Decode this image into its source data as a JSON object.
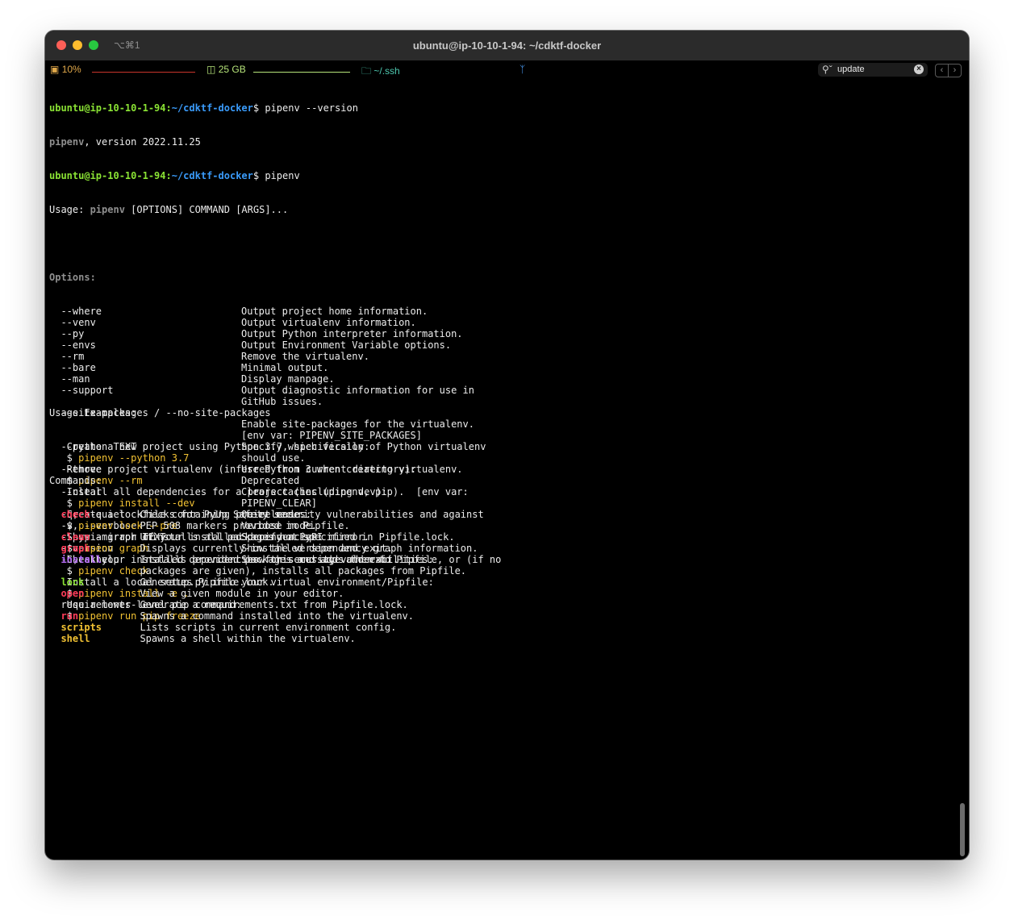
{
  "window": {
    "title": "ubuntu@ip-10-10-1-94: ~/cdktf-docker",
    "shortcut": "⌥⌘1"
  },
  "status": {
    "cpu": "10%",
    "disk": "25 GB",
    "dir": "~/.ssh"
  },
  "search": {
    "value": "update"
  },
  "prompt": {
    "user": "ubuntu@ip-10-10-1-94:",
    "path": "~/cdktf-docker",
    "symbol": "$"
  },
  "commands": {
    "first": " pipenv --version",
    "second": " pipenv"
  },
  "output": {
    "version_prog": "pipenv",
    "version_rest": ", version 2022.11.25",
    "usage_pre": "Usage: ",
    "usage_prog": "pipenv",
    "usage_rest": " [OPTIONS] COMMAND [ARGS]...",
    "options_header": "Options:",
    "options": [
      {
        "flag": "  --where",
        "desc": "Output project home information."
      },
      {
        "flag": "  --venv",
        "desc": "Output virtualenv information."
      },
      {
        "flag": "  --py",
        "desc": "Output Python interpreter information."
      },
      {
        "flag": "  --envs",
        "desc": "Output Environment Variable options."
      },
      {
        "flag": "  --rm",
        "desc": "Remove the virtualenv."
      },
      {
        "flag": "  --bare",
        "desc": "Minimal output."
      },
      {
        "flag": "  --man",
        "desc": "Display manpage."
      },
      {
        "flag": "  --support",
        "desc": "Output diagnostic information for use in"
      },
      {
        "flag": "",
        "desc": "GitHub issues."
      },
      {
        "flag": "  --site-packages / --no-site-packages",
        "desc": ""
      },
      {
        "flag": "",
        "desc": "Enable site-packages for the virtualenv."
      },
      {
        "flag": "",
        "desc": "[env var: PIPENV_SITE_PACKAGES]"
      },
      {
        "flag": "  --python TEXT",
        "desc": "Specify which version of Python virtualenv"
      },
      {
        "flag": "",
        "desc": "should use."
      },
      {
        "flag": "  --three",
        "desc": "Use Python 3 when creating virtualenv."
      },
      {
        "flag": "",
        "desc": "Deprecated"
      },
      {
        "flag": "  --clear",
        "desc": "Clears caches (pipenv, pip).  [env var:"
      },
      {
        "flag": "",
        "desc": "PIPENV_CLEAR]"
      },
      {
        "flag": "  -q, --quiet",
        "desc": "Quiet mode."
      },
      {
        "flag": "  -v, --verbose",
        "desc": "Verbose mode."
      },
      {
        "flag": "  --pypi-mirror TEXT",
        "desc": "Specify a PyPI mirror."
      },
      {
        "flag": "  --version",
        "desc": "Show the version and exit."
      },
      {
        "flag": "  -h, --help",
        "desc": "Show this message and exit."
      }
    ],
    "examples_header": "Usage Examples:",
    "examples": [
      {
        "desc": "   Create a new project using Python 3.7, specifically:",
        "cmd": "pipenv --python 3.7"
      },
      {
        "desc": "   Remove project virtualenv (inferred from current directory):",
        "cmd": "pipenv --rm"
      },
      {
        "desc": "   Install all dependencies for a project (including dev):",
        "cmd": "pipenv install --dev"
      },
      {
        "desc": "   Create a lockfile containing pre-releases:",
        "cmd": "pipenv lock --pre"
      },
      {
        "desc": "   Show a graph of your installed dependencies:",
        "cmd": "pipenv graph"
      },
      {
        "desc": "   Check your installed dependencies for security vulnerabilities:",
        "cmd": "pipenv check"
      },
      {
        "desc": "   Install a local setup.py into your virtual environment/Pipfile:",
        "cmd": "pipenv install -e ."
      },
      {
        "desc": "   Use a lower-level pip command:",
        "cmd": "pipenv run pip freeze"
      }
    ],
    "example_dollar": "   $ ",
    "commands_header": "Commands:",
    "command_list": [
      {
        "name": "check",
        "color": "red",
        "desc": "Checks for PyUp Safety security vulnerabilities and against"
      },
      {
        "name": "",
        "color": "",
        "desc": "PEP 508 markers provided in Pipfile."
      },
      {
        "name": "clean",
        "color": "red",
        "desc": "Uninstalls all packages not specified in Pipfile.lock."
      },
      {
        "name": "graph",
        "color": "red",
        "desc": "Displays currently-installed dependency graph information."
      },
      {
        "name": "install",
        "color": "pur",
        "desc": "Installs provided packages and adds them to Pipfile, or (if no"
      },
      {
        "name": "",
        "color": "",
        "desc": "packages are given), installs all packages from Pipfile."
      },
      {
        "name": "lock",
        "color": "grn",
        "desc": "Generates Pipfile.lock."
      },
      {
        "name": "open",
        "color": "red",
        "desc": "View a given module in your editor."
      },
      {
        "name": "requirements",
        "color": "wb",
        "desc": "Generate a requirements.txt from Pipfile.lock."
      },
      {
        "name": "run",
        "color": "red",
        "desc": "Spawns a command installed into the virtualenv."
      },
      {
        "name": "scripts",
        "color": "ylb",
        "desc": "Lists scripts in current environment config."
      },
      {
        "name": "shell",
        "color": "ylb",
        "desc": "Spawns a shell within the virtualenv."
      }
    ]
  }
}
